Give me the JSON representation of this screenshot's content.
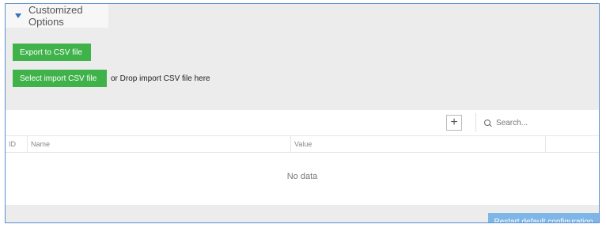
{
  "panel": {
    "title": "Customized Options",
    "export_label": "Export to CSV file",
    "import_label": "Select import CSV file",
    "drop_hint": "or Drop import CSV file here"
  },
  "grid": {
    "search_placeholder": "Search...",
    "add_symbol": "+",
    "columns": [
      "ID",
      "Name",
      "Value"
    ],
    "empty_text": "No data"
  },
  "footer": {
    "restart_label": "Restart default configuration"
  },
  "colors": {
    "green_button": "#3fb24a",
    "blue_button": "#7eb6e8",
    "border": "#5b8fd0"
  },
  "icons": [
    "collapse-triangle-icon",
    "plus-icon",
    "search-icon"
  ]
}
